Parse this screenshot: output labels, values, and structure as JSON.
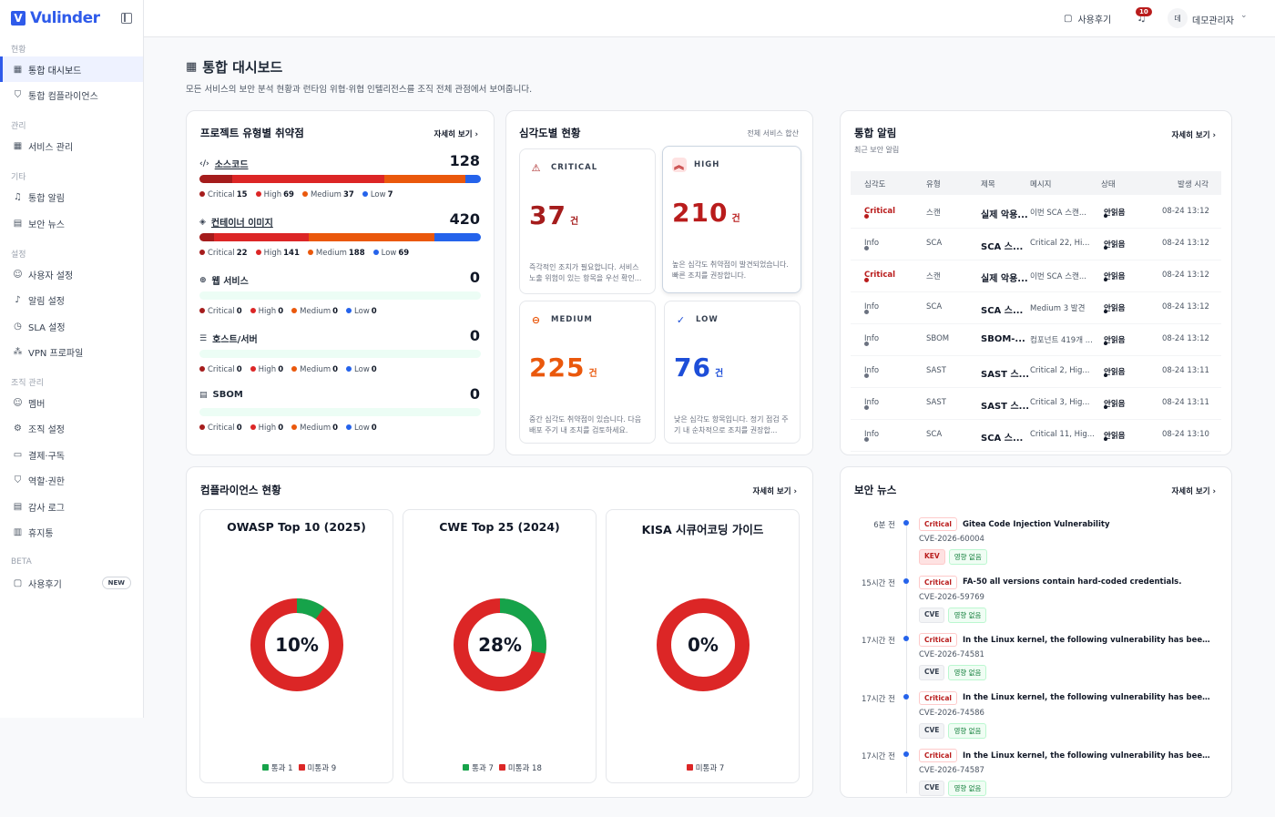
{
  "brand": "Vulinder",
  "nav": {
    "sec_status": "현황",
    "dashboard": "통합 대시보드",
    "compliance": "통합 컴플라이언스",
    "sec_manage": "관리",
    "service_mgmt": "서비스 관리",
    "sec_etc": "기타",
    "alerts": "통합 알림",
    "news": "보안 뉴스",
    "sec_settings": "설정",
    "user_settings": "사용자 설정",
    "alert_settings": "알림 설정",
    "sla": "SLA 설정",
    "vpn": "VPN 프로파일",
    "sec_org": "조직 관리",
    "members": "멤버",
    "org_settings": "조직 설정",
    "billing": "결제·구독",
    "roles": "역할·권한",
    "audit": "감사 로그",
    "trash": "휴지통",
    "sec_beta": "BETA",
    "review": "사용후기",
    "new_badge": "NEW"
  },
  "topbar": {
    "review": "사용후기",
    "bell_count": "10",
    "avatar": "데",
    "user": "데모관리자"
  },
  "page": {
    "title": "통합 대시보드",
    "subtitle": "모든 서비스의 보안 분석 현황과 런타임 위협·위협 인텔리전스를 조직 전체 관점에서 보여줍니다."
  },
  "colors": {
    "critical": "#a51c1c",
    "high": "#dc2626",
    "medium": "#ea580c",
    "low": "#2563eb",
    "pass": "#16a34a",
    "fail": "#dc2626"
  },
  "vuln": {
    "title": "프로젝트 유형별 취약점",
    "more": "자세히 보기",
    "rows": [
      {
        "name": "소스코드",
        "total": "128",
        "critical": 15,
        "high": 69,
        "medium": 37,
        "low": 7
      },
      {
        "name": "컨테이너 이미지",
        "total": "420",
        "critical": 22,
        "high": 141,
        "medium": 188,
        "low": 69
      },
      {
        "name": "웹 서비스",
        "total": "0",
        "critical": 0,
        "high": 0,
        "medium": 0,
        "low": 0
      },
      {
        "name": "호스트/서버",
        "total": "0",
        "critical": 0,
        "high": 0,
        "medium": 0,
        "low": 0
      },
      {
        "name": "SBOM",
        "total": "0",
        "critical": 0,
        "high": 0,
        "medium": 0,
        "low": 0
      }
    ],
    "labels": {
      "critical": "Critical",
      "high": "High",
      "medium": "Medium",
      "low": "Low"
    }
  },
  "severity": {
    "title": "심각도별 현황",
    "note": "전체 서비스 합산",
    "unit": "건",
    "cards": [
      {
        "label": "CRITICAL",
        "value": "37",
        "desc": "즉각적인 조치가 필요합니다. 서비스 노출 위험이 있는 항목을 우선 확인...",
        "color": "#a51c1c"
      },
      {
        "label": "HIGH",
        "value": "210",
        "desc": "높은 심각도 취약점이 발견되었습니다. 빠른 조치를 권장합니다.",
        "color": "#b91c1c"
      },
      {
        "label": "MEDIUM",
        "value": "225",
        "desc": "중간 심각도 취약점이 있습니다. 다음 배포 주기 내 조치를 검토하세요.",
        "color": "#ea580c"
      },
      {
        "label": "LOW",
        "value": "76",
        "desc": "낮은 심각도 항목입니다. 정기 점검 주기 내 순차적으로 조치를 권장합...",
        "color": "#1d4ed8"
      }
    ]
  },
  "alerts": {
    "title": "통합 알림",
    "subtitle": "최근 보안 알림",
    "more": "자세히 보기",
    "headers": [
      "심각도",
      "유형",
      "제목",
      "메시지",
      "상태",
      "발생 시각"
    ],
    "rows": [
      {
        "sev": "Critical",
        "type": "스캔",
        "title": "실제 악용...",
        "msg": "이번 SCA 스캔...",
        "status": "안읽음",
        "time": "08-24 13:12"
      },
      {
        "sev": "Info",
        "type": "SCA",
        "title": "SCA 스...",
        "msg": "Critical 22, Hi...",
        "status": "안읽음",
        "time": "08-24 13:12"
      },
      {
        "sev": "Critical",
        "type": "스캔",
        "title": "실제 악용...",
        "msg": "이번 SCA 스캔...",
        "status": "안읽음",
        "time": "08-24 13:12"
      },
      {
        "sev": "Info",
        "type": "SCA",
        "title": "SCA 스...",
        "msg": "Medium 3 발견",
        "status": "안읽음",
        "time": "08-24 13:12"
      },
      {
        "sev": "Info",
        "type": "SBOM",
        "title": "SBOM-...",
        "msg": "컴포넌트 419개 ...",
        "status": "안읽음",
        "time": "08-24 13:12"
      },
      {
        "sev": "Info",
        "type": "SAST",
        "title": "SAST 스...",
        "msg": "Critical 2, Hig...",
        "status": "안읽음",
        "time": "08-24 13:11"
      },
      {
        "sev": "Info",
        "type": "SAST",
        "title": "SAST 스...",
        "msg": "Critical 3, Hig...",
        "status": "안읽음",
        "time": "08-24 13:11"
      },
      {
        "sev": "Info",
        "type": "SCA",
        "title": "SCA 스...",
        "msg": "Critical 11, Hig...",
        "status": "안읽음",
        "time": "08-24 13:10"
      }
    ]
  },
  "compliance": {
    "title": "컴플라이언스 현황",
    "more": "자세히 보기",
    "pass_label": "통과",
    "fail_label": "미통과",
    "items": [
      {
        "name": "OWASP Top 10 (2025)",
        "percent": "10%",
        "pass": 1,
        "fail": 9,
        "pass_text": "통과 1",
        "fail_text": "미통과 9"
      },
      {
        "name": "CWE Top 25 (2024)",
        "percent": "28%",
        "pass": 7,
        "fail": 18,
        "pass_text": "통과 7",
        "fail_text": "미통과 18"
      },
      {
        "name": "KISA 시큐어코딩 가이드",
        "percent": "0%",
        "pass": 0,
        "fail": 7,
        "pass_text": "",
        "fail_text": "미통과 7"
      }
    ]
  },
  "news": {
    "title": "보안 뉴스",
    "more": "자세히 보기",
    "items": [
      {
        "time": "6분 전",
        "sev": "Critical",
        "title": "Gitea Code Injection Vulnerability",
        "id": "CVE-2026-60004",
        "tag1": "KEV",
        "tag2": "영향 없음"
      },
      {
        "time": "15시간 전",
        "sev": "Critical",
        "title": "FA-50 all versions contain hard-coded credentials.",
        "id": "CVE-2026-59769",
        "tag1": "CVE",
        "tag2": "영향 없음"
      },
      {
        "time": "17시간 전",
        "sev": "Critical",
        "title": "In the Linux kernel, the following vulnerability has been resol...",
        "id": "CVE-2026-74581",
        "tag1": "CVE",
        "tag2": "영향 없음"
      },
      {
        "time": "17시간 전",
        "sev": "Critical",
        "title": "In the Linux kernel, the following vulnerability has been resol...",
        "id": "CVE-2026-74586",
        "tag1": "CVE",
        "tag2": "영향 없음"
      },
      {
        "time": "17시간 전",
        "sev": "Critical",
        "title": "In the Linux kernel, the following vulnerability has been resol...",
        "id": "CVE-2026-74587",
        "tag1": "CVE",
        "tag2": "영향 없음"
      }
    ]
  },
  "icons": {
    "grid": "grid-icon",
    "shield": "shield-icon",
    "bell": "bell-icon",
    "news": "newspaper-icon",
    "user": "user-icon",
    "timer": "timer-icon",
    "network": "network-icon",
    "gear": "gear-icon",
    "card": "credit-card-icon",
    "role": "role-icon",
    "log": "log-icon",
    "trash": "trash-icon",
    "chat": "chat-icon"
  }
}
